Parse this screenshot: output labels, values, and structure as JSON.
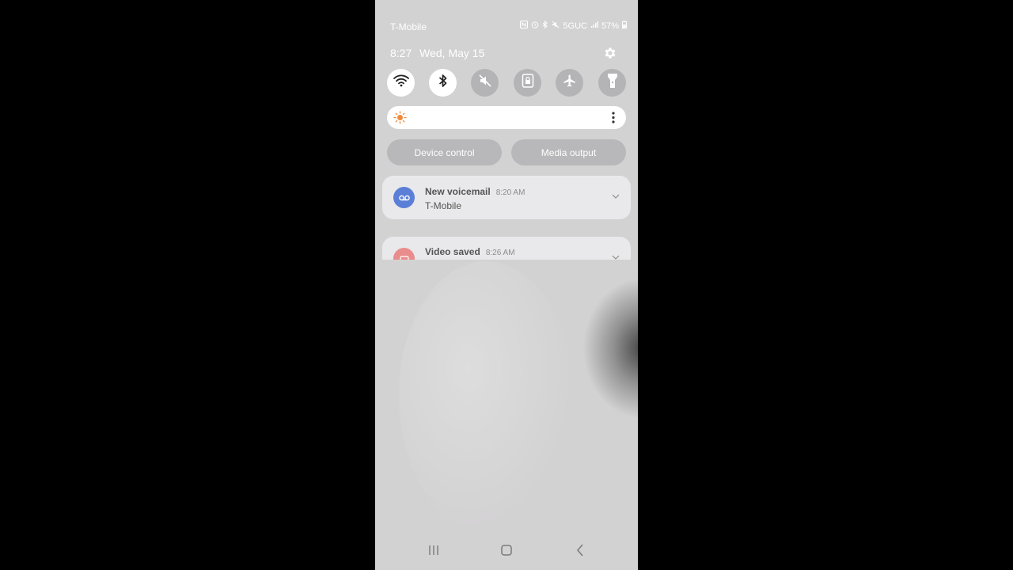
{
  "status_bar": {
    "carrier": "T-Mobile",
    "network": "5GUC",
    "battery": "57%",
    "icons": [
      "nfc-icon",
      "alarm-icon",
      "bluetooth-status-icon",
      "mute-status-icon",
      "signal-icon",
      "battery-icon"
    ]
  },
  "panel": {
    "time": "8:27",
    "date": "Wed, May 15"
  },
  "quick_settings": [
    {
      "name": "wifi",
      "icon": "wifi-icon",
      "state": "on"
    },
    {
      "name": "bluetooth",
      "icon": "bluetooth-icon",
      "state": "on"
    },
    {
      "name": "sound",
      "icon": "mute-icon",
      "state": "off"
    },
    {
      "name": "portrait-lock",
      "icon": "rotation-lock-icon",
      "state": "off"
    },
    {
      "name": "airplane",
      "icon": "airplane-icon",
      "state": "off"
    },
    {
      "name": "flashlight",
      "icon": "flashlight-icon",
      "state": "off"
    }
  ],
  "brightness": {
    "icon": "sun-icon"
  },
  "buttons": {
    "device_control": "Device control",
    "media_output": "Media output"
  },
  "notifications": [
    {
      "title": "New voicemail",
      "time": "8:20 AM",
      "text": "T-Mobile",
      "icon": "voicemail-icon",
      "color": "#5b7fd6"
    },
    {
      "title": "Video saved",
      "time": "8:26 AM",
      "icon": "video-icon",
      "color": "#e98c8c"
    }
  ],
  "colors": {
    "panel_bg": "#d3d2d3",
    "tile_on": "#ffffff",
    "tile_off": "#b4b3b5",
    "accent_sun": "#f08a3c"
  }
}
